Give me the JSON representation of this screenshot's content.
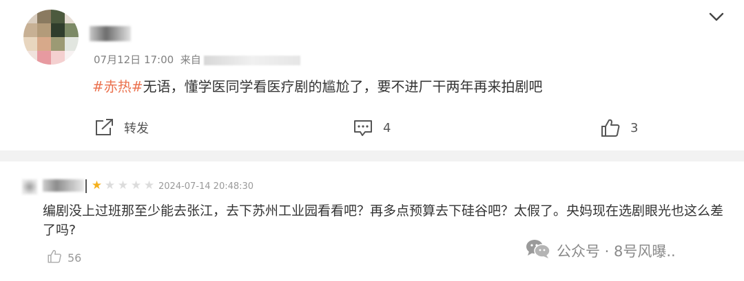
{
  "post": {
    "date": "07月12日 17:00",
    "source_prefix": "来自",
    "hashtag": "#赤热#",
    "text": "无语，懂学医同学看医疗剧的尴尬了，要不进厂干两年再来拍剧吧",
    "forward_label": "转发",
    "comment_count": "4",
    "like_count": "3",
    "icons": {
      "menu": "chevron-down-icon",
      "forward": "share-icon",
      "comment": "comment-icon",
      "like": "thumbs-up-icon"
    }
  },
  "review": {
    "rating": 1,
    "rating_max": 5,
    "date": "2024-07-14 20:48:30",
    "text": "编剧没上过班那至少能去张江，去下苏州工业园看看吧？再多点预算去下硅谷吧？太假了。央妈现在选剧眼光也这么差了吗?",
    "like_count": "56",
    "icons": {
      "like": "thumbs-up-icon"
    }
  },
  "watermark": {
    "text": "公众号 · 8号风曝..",
    "icon": "wechat-icon"
  },
  "colors": {
    "hashtag": "#eb7350",
    "star_on": "#f5b01c",
    "star_off": "#dcdcdc",
    "divider": "#f2f2f2"
  }
}
